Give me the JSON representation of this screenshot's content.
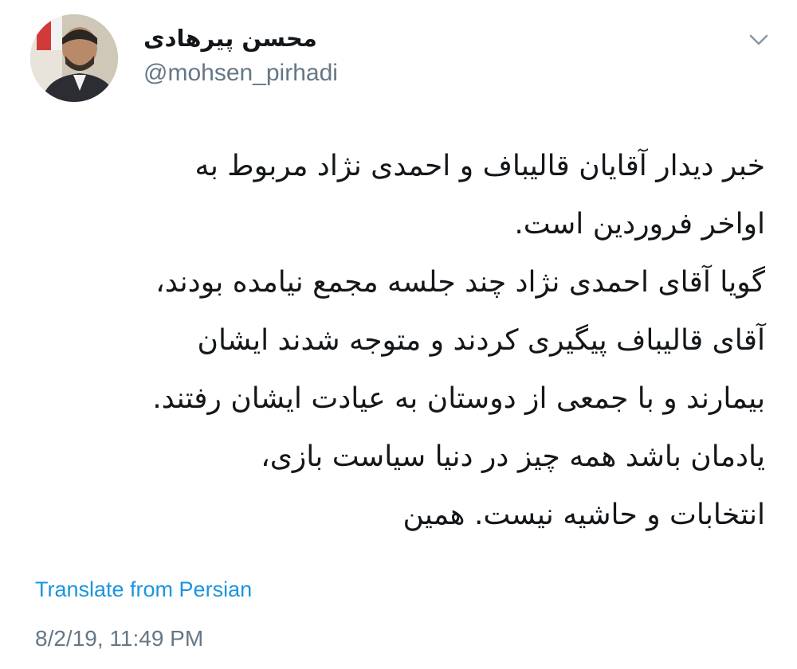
{
  "author": {
    "display_name": "محسن پیرهادی",
    "handle": "@mohsen_pirhadi",
    "avatar_icon": "profile-photo"
  },
  "menu_icon": "chevron-down-icon",
  "tweet": {
    "lines": [
      "خبر دیدار آقایان قالیباف و احمدی نژاد مربوط به",
      "اواخر فروردین است.",
      "گویا آقای احمدی نژاد چند جلسه مجمع نیامده بودند،",
      "آقای قالیباف پیگیری کردند و متوجه شدند ایشان",
      "بیمارند و با جمعی از دوستان به عیادت ایشان رفتند.",
      "یادمان باشد همه چیز در دنیا  سیاست بازی،",
      "انتخابات و حاشیه نیست. همین"
    ],
    "translate_label": "Translate from Persian",
    "timestamp": "8/2/19, 11:49 PM"
  },
  "colors": {
    "text": "#14171a",
    "secondary": "#657786",
    "link": "#1b95e0"
  }
}
